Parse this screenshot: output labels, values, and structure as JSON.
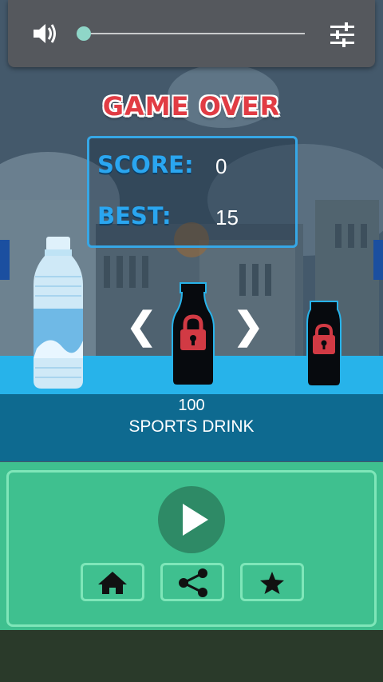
{
  "title": "GAME OVER",
  "stats": {
    "score_label": "SCORE:",
    "score_value": "0",
    "best_label": "BEST:",
    "best_value": "15"
  },
  "volume": {
    "level": 0.0,
    "speaker_icon": "speaker-icon",
    "settings_icon": "tune-sliders-icon"
  },
  "selector": {
    "prev_label": "❮",
    "next_label": "❯",
    "price": "100",
    "name": "SPORTS DRINK",
    "bottles": [
      {
        "name": "water-bottle",
        "locked": false
      },
      {
        "name": "sports-drink-bottle",
        "locked": true
      },
      {
        "name": "next-bottle",
        "locked": true
      }
    ]
  },
  "menu": {
    "play_icon": "play-icon",
    "home_icon": "home-icon",
    "share_icon": "share-icon",
    "star_icon": "star-icon"
  },
  "colors": {
    "title_red": "#e13c44",
    "label_blue": "#2aa6f0",
    "menu_green": "#3fc08f",
    "shelf_blue": "#27b3ea"
  }
}
